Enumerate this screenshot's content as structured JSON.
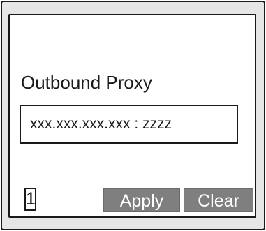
{
  "screen": {
    "title": "Outbound Proxy",
    "address_value": "xxx.xxx.xxx.xxx : zzzz",
    "line_number": "1"
  },
  "softkeys": {
    "apply_label": "Apply",
    "clear_label": "Clear"
  },
  "colors": {
    "softkey_background": "#7f7f7f",
    "softkey_text": "#ffffff",
    "bezel": "#e6e6e6",
    "screen": "#ffffff"
  }
}
